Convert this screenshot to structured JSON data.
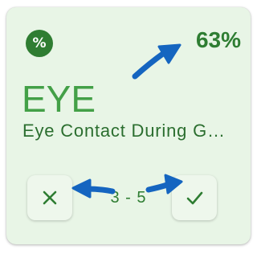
{
  "card": {
    "badge_icon": "percent-icon",
    "badge_symbol": "%",
    "percentage": "63%",
    "percentage_value": 63,
    "code": "EYE",
    "description": "Eye Contact During Gr…",
    "range": "3 - 5",
    "reject_icon": "close-icon",
    "accept_icon": "check-icon"
  },
  "annotations": {
    "arrow_color": "#1565c0",
    "arrows": [
      "arrow-to-percentage",
      "arrow-to-reject",
      "arrow-to-accept"
    ]
  },
  "colors": {
    "card_background": "#e8f5e6",
    "accent_green": "#2e7d32",
    "code_green": "#43a047"
  }
}
